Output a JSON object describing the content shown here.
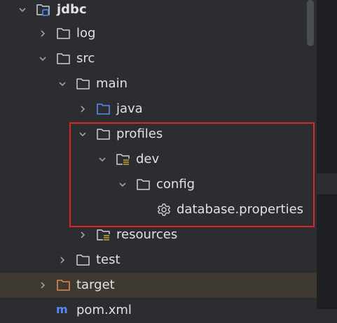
{
  "tree": {
    "root": {
      "label": "jdbc",
      "icon": "module-folder-icon",
      "expanded": true
    },
    "log": {
      "label": "log",
      "icon": "folder-icon",
      "expanded": false
    },
    "src": {
      "label": "src",
      "icon": "folder-icon",
      "expanded": true
    },
    "main": {
      "label": "main",
      "icon": "folder-icon",
      "expanded": true
    },
    "java": {
      "label": "java",
      "icon": "source-folder-icon",
      "expanded": false
    },
    "profiles": {
      "label": "profiles",
      "icon": "folder-icon",
      "expanded": true
    },
    "dev": {
      "label": "dev",
      "icon": "resource-folder-icon",
      "expanded": true
    },
    "config": {
      "label": "config",
      "icon": "folder-icon",
      "expanded": true
    },
    "database_properties": {
      "label": "database.properties",
      "icon": "gear-icon"
    },
    "resources": {
      "label": "resources",
      "icon": "resource-folder-icon",
      "expanded": false
    },
    "test": {
      "label": "test",
      "icon": "folder-icon",
      "expanded": false
    },
    "target": {
      "label": "target",
      "icon": "excluded-folder-icon",
      "expanded": false,
      "selected": true
    },
    "pom": {
      "label": "pom.xml",
      "icon": "maven-icon"
    }
  },
  "colors": {
    "background": "#2b2d30",
    "selected_row": "#3e3a31",
    "highlight_border": "#e02424",
    "source_folder": "#548af7",
    "excluded_folder": "#e08855",
    "resource_lines": "#c9a03d"
  }
}
